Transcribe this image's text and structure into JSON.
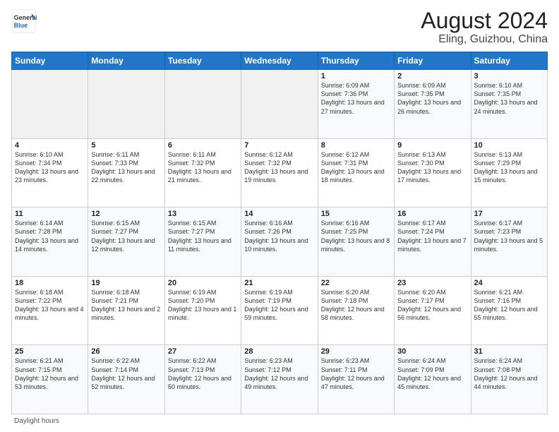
{
  "header": {
    "logo_general": "General",
    "logo_blue": "Blue",
    "title": "August 2024",
    "subtitle": "Eling, Guizhou, China"
  },
  "days_of_week": [
    "Sunday",
    "Monday",
    "Tuesday",
    "Wednesday",
    "Thursday",
    "Friday",
    "Saturday"
  ],
  "weeks": [
    [
      {
        "day": "",
        "info": ""
      },
      {
        "day": "",
        "info": ""
      },
      {
        "day": "",
        "info": ""
      },
      {
        "day": "",
        "info": ""
      },
      {
        "day": "1",
        "info": "Sunrise: 6:09 AM\nSunset: 7:36 PM\nDaylight: 13 hours\nand 27 minutes."
      },
      {
        "day": "2",
        "info": "Sunrise: 6:09 AM\nSunset: 7:35 PM\nDaylight: 13 hours\nand 26 minutes."
      },
      {
        "day": "3",
        "info": "Sunrise: 6:10 AM\nSunset: 7:35 PM\nDaylight: 13 hours\nand 24 minutes."
      }
    ],
    [
      {
        "day": "4",
        "info": "Sunrise: 6:10 AM\nSunset: 7:34 PM\nDaylight: 13 hours\nand 23 minutes."
      },
      {
        "day": "5",
        "info": "Sunrise: 6:11 AM\nSunset: 7:33 PM\nDaylight: 13 hours\nand 22 minutes."
      },
      {
        "day": "6",
        "info": "Sunrise: 6:11 AM\nSunset: 7:32 PM\nDaylight: 13 hours\nand 21 minutes."
      },
      {
        "day": "7",
        "info": "Sunrise: 6:12 AM\nSunset: 7:32 PM\nDaylight: 13 hours\nand 19 minutes."
      },
      {
        "day": "8",
        "info": "Sunrise: 6:12 AM\nSunset: 7:31 PM\nDaylight: 13 hours\nand 18 minutes."
      },
      {
        "day": "9",
        "info": "Sunrise: 6:13 AM\nSunset: 7:30 PM\nDaylight: 13 hours\nand 17 minutes."
      },
      {
        "day": "10",
        "info": "Sunrise: 6:13 AM\nSunset: 7:29 PM\nDaylight: 13 hours\nand 15 minutes."
      }
    ],
    [
      {
        "day": "11",
        "info": "Sunrise: 6:14 AM\nSunset: 7:28 PM\nDaylight: 13 hours\nand 14 minutes."
      },
      {
        "day": "12",
        "info": "Sunrise: 6:15 AM\nSunset: 7:27 PM\nDaylight: 13 hours\nand 12 minutes."
      },
      {
        "day": "13",
        "info": "Sunrise: 6:15 AM\nSunset: 7:27 PM\nDaylight: 13 hours\nand 11 minutes."
      },
      {
        "day": "14",
        "info": "Sunrise: 6:16 AM\nSunset: 7:26 PM\nDaylight: 13 hours\nand 10 minutes."
      },
      {
        "day": "15",
        "info": "Sunrise: 6:16 AM\nSunset: 7:25 PM\nDaylight: 13 hours\nand 8 minutes."
      },
      {
        "day": "16",
        "info": "Sunrise: 6:17 AM\nSunset: 7:24 PM\nDaylight: 13 hours\nand 7 minutes."
      },
      {
        "day": "17",
        "info": "Sunrise: 6:17 AM\nSunset: 7:23 PM\nDaylight: 13 hours\nand 5 minutes."
      }
    ],
    [
      {
        "day": "18",
        "info": "Sunrise: 6:18 AM\nSunset: 7:22 PM\nDaylight: 13 hours\nand 4 minutes."
      },
      {
        "day": "19",
        "info": "Sunrise: 6:18 AM\nSunset: 7:21 PM\nDaylight: 13 hours\nand 2 minutes."
      },
      {
        "day": "20",
        "info": "Sunrise: 6:19 AM\nSunset: 7:20 PM\nDaylight: 13 hours\nand 1 minute."
      },
      {
        "day": "21",
        "info": "Sunrise: 6:19 AM\nSunset: 7:19 PM\nDaylight: 12 hours\nand 59 minutes."
      },
      {
        "day": "22",
        "info": "Sunrise: 6:20 AM\nSunset: 7:18 PM\nDaylight: 12 hours\nand 58 minutes."
      },
      {
        "day": "23",
        "info": "Sunrise: 6:20 AM\nSunset: 7:17 PM\nDaylight: 12 hours\nand 56 minutes."
      },
      {
        "day": "24",
        "info": "Sunrise: 6:21 AM\nSunset: 7:16 PM\nDaylight: 12 hours\nand 55 minutes."
      }
    ],
    [
      {
        "day": "25",
        "info": "Sunrise: 6:21 AM\nSunset: 7:15 PM\nDaylight: 12 hours\nand 53 minutes."
      },
      {
        "day": "26",
        "info": "Sunrise: 6:22 AM\nSunset: 7:14 PM\nDaylight: 12 hours\nand 52 minutes."
      },
      {
        "day": "27",
        "info": "Sunrise: 6:22 AM\nSunset: 7:13 PM\nDaylight: 12 hours\nand 50 minutes."
      },
      {
        "day": "28",
        "info": "Sunrise: 6:23 AM\nSunset: 7:12 PM\nDaylight: 12 hours\nand 49 minutes."
      },
      {
        "day": "29",
        "info": "Sunrise: 6:23 AM\nSunset: 7:11 PM\nDaylight: 12 hours\nand 47 minutes."
      },
      {
        "day": "30",
        "info": "Sunrise: 6:24 AM\nSunset: 7:09 PM\nDaylight: 12 hours\nand 45 minutes."
      },
      {
        "day": "31",
        "info": "Sunrise: 6:24 AM\nSunset: 7:08 PM\nDaylight: 12 hours\nand 44 minutes."
      }
    ]
  ],
  "footer": {
    "daylight_label": "Daylight hours"
  }
}
